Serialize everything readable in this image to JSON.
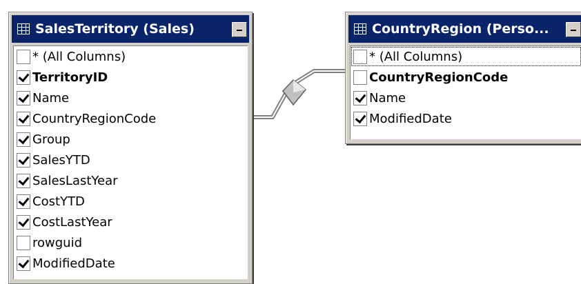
{
  "tables": [
    {
      "title": "SalesTerritory (Sales)",
      "icon": "table-grid-icon",
      "columns": [
        {
          "label": "* (All Columns)",
          "checked": false,
          "bold": false
        },
        {
          "label": "TerritoryID",
          "checked": true,
          "bold": true
        },
        {
          "label": "Name",
          "checked": true,
          "bold": false
        },
        {
          "label": "CountryRegionCode",
          "checked": true,
          "bold": false
        },
        {
          "label": "Group",
          "checked": true,
          "bold": false
        },
        {
          "label": "SalesYTD",
          "checked": true,
          "bold": false
        },
        {
          "label": "SalesLastYear",
          "checked": true,
          "bold": false
        },
        {
          "label": "CostYTD",
          "checked": true,
          "bold": false
        },
        {
          "label": "CostLastYear",
          "checked": true,
          "bold": false
        },
        {
          "label": "rowguid",
          "checked": false,
          "bold": false
        },
        {
          "label": "ModifiedDate",
          "checked": true,
          "bold": false
        }
      ]
    },
    {
      "title": "CountryRegion (Perso...",
      "icon": "table-grid-icon",
      "columns": [
        {
          "label": "* (All Columns)",
          "checked": false,
          "bold": false,
          "focused": true
        },
        {
          "label": "CountryRegionCode",
          "checked": false,
          "bold": true
        },
        {
          "label": "Name",
          "checked": true,
          "bold": false
        },
        {
          "label": "ModifiedDate",
          "checked": true,
          "bold": false
        }
      ]
    }
  ],
  "colors": {
    "title_bar": "#0a246a",
    "window_face": "#d4d0c8"
  }
}
